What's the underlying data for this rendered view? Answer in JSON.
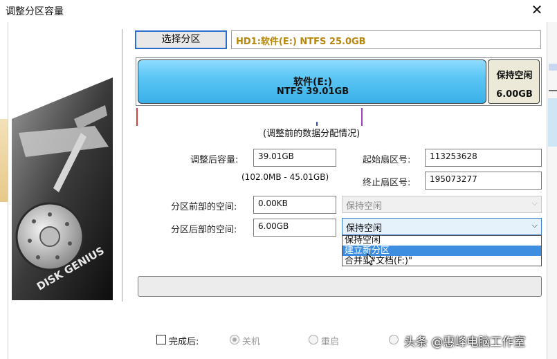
{
  "window": {
    "title": "调整分区容量"
  },
  "select_partition_button": "选择分区",
  "partition_info": "HD1:软件(E:) NTFS 25.0GB",
  "disk_map": {
    "main_name": "软件(E:)",
    "main_detail": "NTFS 39.01GB",
    "free_label": "保持空闲",
    "free_size": "6.00GB"
  },
  "caption": "(调整前的数据分配情况)",
  "resized_capacity": {
    "label": "调整后容量:",
    "value": "39.01GB",
    "range": "(102.0MB - 45.01GB)"
  },
  "start_sector": {
    "label": "起始扇区号:",
    "value": "113253628"
  },
  "end_sector": {
    "label": "终止扇区号:",
    "value": "195073277"
  },
  "space_before": {
    "label": "分区前部的空间:",
    "value": "0.00KB",
    "select": "保持空闲"
  },
  "space_after": {
    "label": "分区后部的空间:",
    "value": "6.00GB",
    "select": "保持空闲"
  },
  "dropdown_options": [
    "保持空闲",
    "建立新分区",
    "合并到\"文档(F:)\""
  ],
  "after_complete": {
    "label": "完成后:",
    "options": [
      "关机",
      "重启"
    ]
  },
  "watermark": "头条 @惠峰电脑工作室",
  "logo_text": "DISK GENIUS",
  "colors": {
    "accent": "#5fbff0",
    "selected_row": "#3d8ee0",
    "border": "#7a7a7a"
  }
}
